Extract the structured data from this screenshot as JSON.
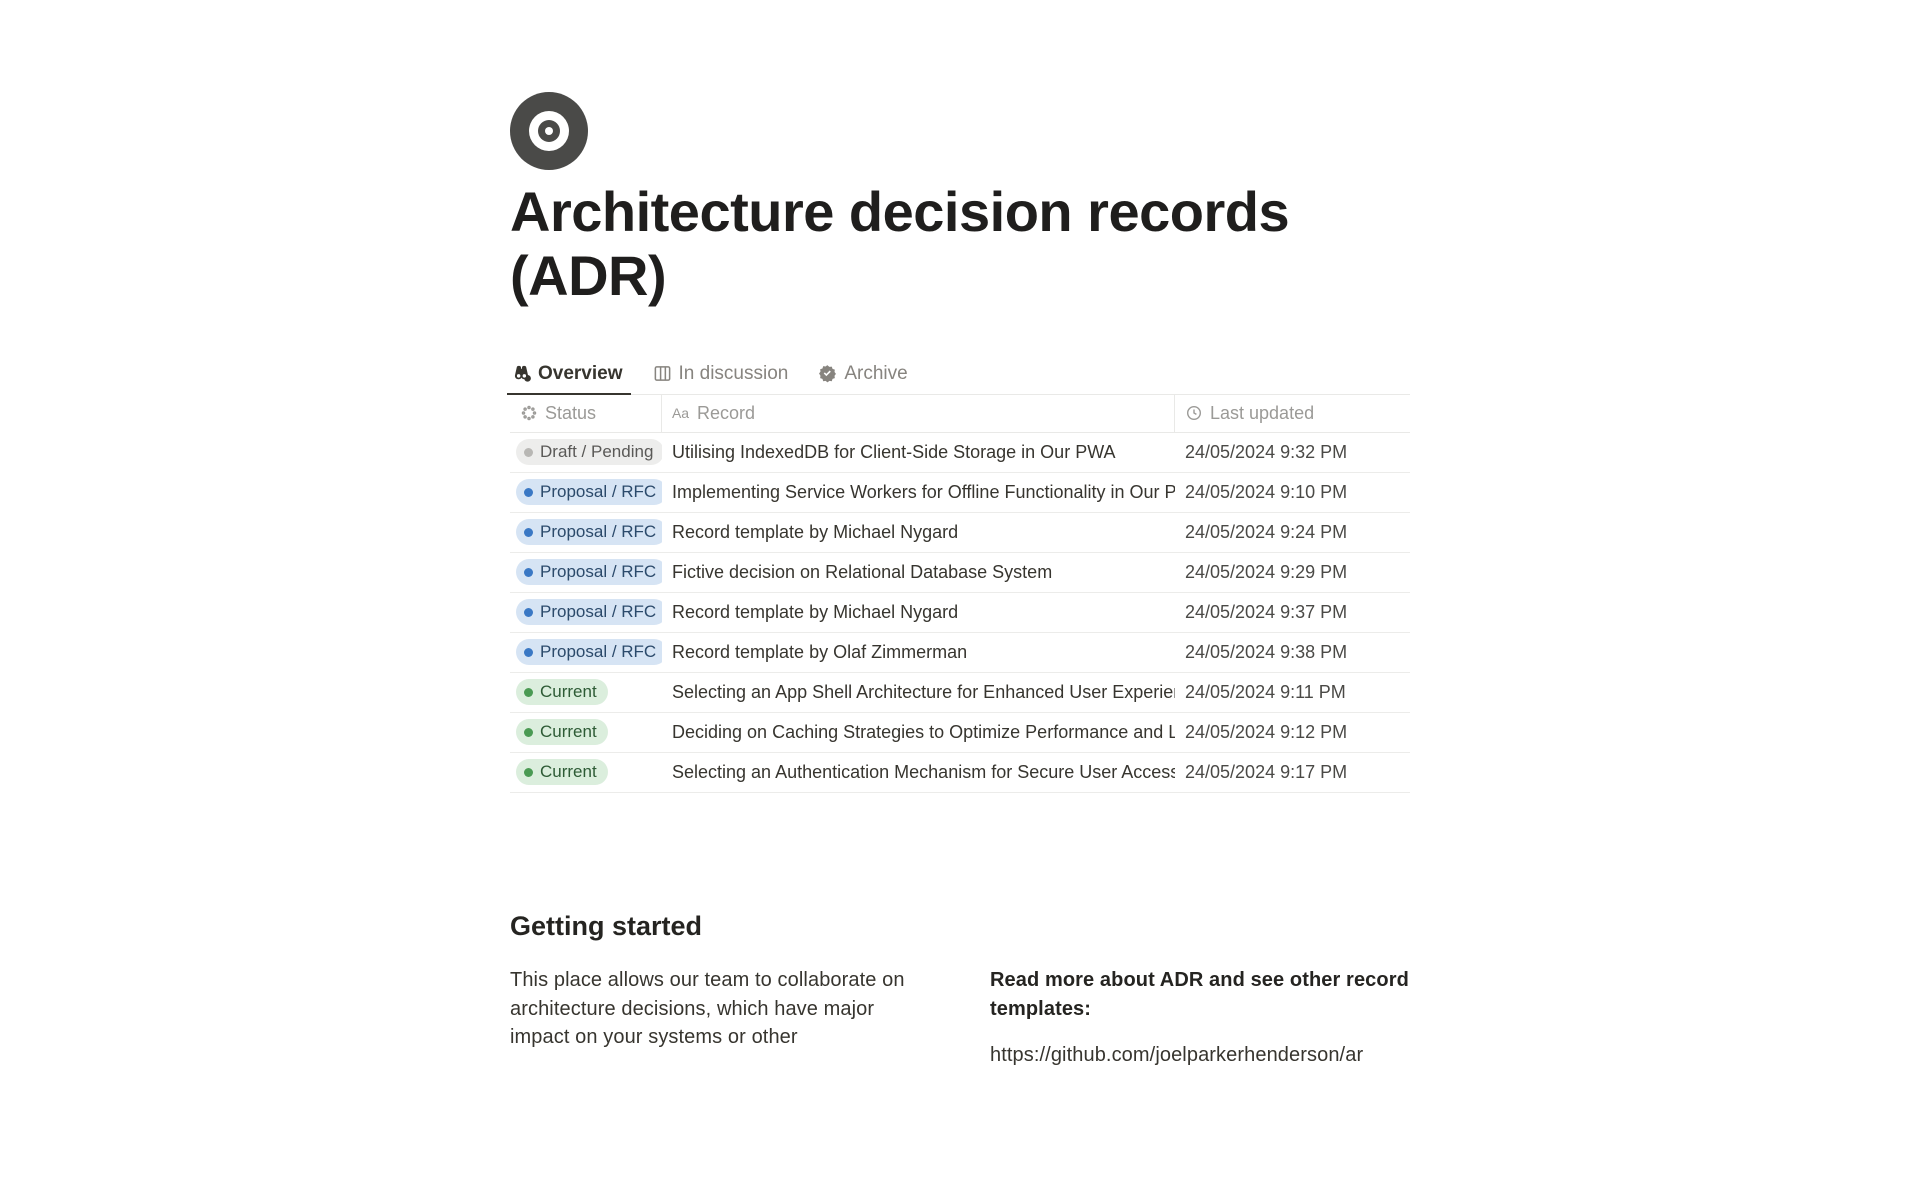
{
  "icon": "target-icon",
  "title": "Architecture decision records (ADR)",
  "tabs": [
    {
      "id": "overview",
      "label": "Overview",
      "icon": "binoculars-icon",
      "active": true
    },
    {
      "id": "discussion",
      "label": "In discussion",
      "icon": "columns-icon",
      "active": false
    },
    {
      "id": "archive",
      "label": "Archive",
      "icon": "badge-icon",
      "active": false
    }
  ],
  "columns": {
    "status": {
      "label": "Status",
      "icon": "status-icon"
    },
    "record": {
      "label": "Record",
      "icon": "text-aa-icon"
    },
    "updated": {
      "label": "Last updated",
      "icon": "clock-icon"
    }
  },
  "status_types": {
    "draft": {
      "label": "Draft / Pending",
      "class": "pill-draft"
    },
    "proposal": {
      "label": "Proposal / RFC",
      "class": "pill-proposal"
    },
    "current": {
      "label": "Current",
      "class": "pill-current"
    }
  },
  "rows": [
    {
      "status": "draft",
      "record": "Utilising IndexedDB for Client-Side Storage in Our PWA",
      "updated": "24/05/2024 9:32 PM"
    },
    {
      "status": "proposal",
      "record": "Implementing Service Workers for Offline Functionality in Our PWA",
      "updated": "24/05/2024 9:10 PM"
    },
    {
      "status": "proposal",
      "record": "Record template by Michael Nygard",
      "updated": "24/05/2024 9:24 PM"
    },
    {
      "status": "proposal",
      "record": "Fictive decision on Relational Database System",
      "updated": "24/05/2024 9:29 PM"
    },
    {
      "status": "proposal",
      "record": "Record template by Michael Nygard",
      "updated": "24/05/2024 9:37 PM"
    },
    {
      "status": "proposal",
      "record": "Record template by Olaf Zimmerman",
      "updated": "24/05/2024 9:38 PM"
    },
    {
      "status": "current",
      "record": "Selecting an App Shell Architecture for Enhanced User Experience",
      "updated": "24/05/2024 9:11 PM"
    },
    {
      "status": "current",
      "record": "Deciding on Caching Strategies to Optimize Performance and Load Times",
      "updated": "24/05/2024 9:12 PM"
    },
    {
      "status": "current",
      "record": "Selecting an Authentication Mechanism for Secure User Access in Our PWA",
      "updated": "24/05/2024 9:17 PM"
    }
  ],
  "getting_started": {
    "heading": "Getting started",
    "left_paragraph": "This place allows our team to collaborate on architecture decisions, which have major impact on your systems or other",
    "right_heading": "Read more about ADR and see other record templates:",
    "right_link": "https://github.com/joelparkerhenderson/ar"
  }
}
